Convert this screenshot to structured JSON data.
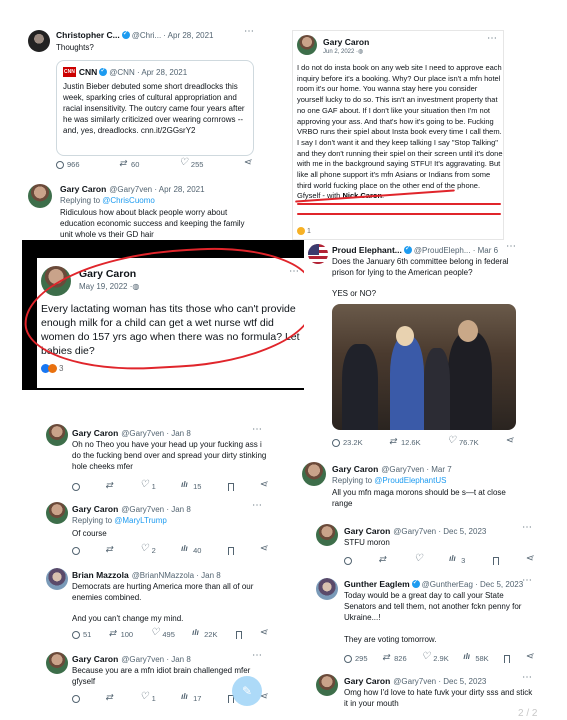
{
  "t1": {
    "name": "Christopher C... ",
    "handle": "@Chri...",
    "date": "· Apr 28, 2021",
    "text": "Thoughts?",
    "quote": {
      "logo": "CNN",
      "name": "CNN",
      "handle": "@CNN · Apr 28, 2021",
      "text": "Justin Bieber debuted some short dreadlocks this week, sparking cries of cultural appropriation and racial insensitivity. The outcry came four years after he was similarly criticized over wearing cornrows -- and, yes, dreadlocks. cnn.it/2GGsrY2"
    },
    "replies": "966",
    "retweets": "60",
    "likes": "255"
  },
  "t2": {
    "name": "Gary Caron",
    "handle": "@Gary7ven · Apr 28, 2021",
    "replying_prefix": "Replying to ",
    "replying_to": "@ChrisCuomo",
    "text": "Ridiculous how about black people worry about education economic success and keeping the family unit whole vs their GD hair"
  },
  "t3": {
    "name": "Gary Caron",
    "date": "Jun 2, 2022 · ",
    "text": "I do not do insta book on any web site I need to approve each inquiry before it's a booking. Why? Our place isn't a mfn hotel room it's our home. You wanna stay here you consider yourself lucky to do so. This isn't an investment property that no one GAF about. If I don't like your situation then I'm not approving your ass. And that's how it's going to be. Fucking VRBO runs their spiel about Insta book every time I call them. I say I don't want it and they keep talking I say \"Stop Talking\" and they don't running their spiel on their screen until it's done with me in the background saying STFU! It's aggravating. But like all phone support it's mfn Asians or Indians from some third world fucking place on the other end of the phone. Gfyself - with ",
    "with_name": "Nick Caron",
    "with_end": ".",
    "reaction_count": "1"
  },
  "t4": {
    "name": "Gary Caron",
    "date": "May 19, 2022 · ",
    "text": "Every lactating woman has tits those who can't provide enough milk for a child can get a wet nurse wtf did women do 157 yrs ago when there was no formula? Let babies die?",
    "reaction_count": "3"
  },
  "t5": {
    "name": "Proud Elephant...",
    "handle": "@ProudEleph... · Mar 6",
    "text": "Does the January 6th committee belong in federal prison for lying to the American people?",
    "text2": "YES or NO?",
    "replies": "23.2K",
    "retweets": "12.6K",
    "likes": "76.7K"
  },
  "t6": {
    "name": "Gary Caron",
    "handle": "@Gary7ven · Mar 7",
    "replying_prefix": "Replying to ",
    "replying_to": "@ProudElephantUS",
    "text": "All you mfn maga morons should be s—t at close range"
  },
  "t7": {
    "name": "Gary Caron",
    "handle": "@Gary7ven · Jan 8",
    "text": "Oh no Theo you have your head up your fucking ass i do the fucking bend over and spread your dirty stinking hole cheeks mfer",
    "likes": "1",
    "views": "15"
  },
  "t8": {
    "name": "Gary Caron",
    "handle": "@Gary7ven · Jan 8",
    "replying_prefix": "Replying to ",
    "replying_to": "@MaryLTrump",
    "text": "Of course",
    "likes": "2",
    "views": "40"
  },
  "t9": {
    "name": "Brian Mazzola",
    "handle": "@BrianNMazzola · Jan 8",
    "text": "Democrats are hurting America more than all of our enemies combined.",
    "text2": "And you can't change my mind.",
    "replies": "51",
    "retweets": "100",
    "likes": "495",
    "views": "22K"
  },
  "t10": {
    "name": "Gary Caron",
    "handle": "@Gary7ven · Jan 8",
    "text": "Because you are a mfn idiot brain challenged mfer gfyself",
    "likes": "1",
    "views": "17"
  },
  "t11": {
    "name": "Gary Caron",
    "handle": "@Gary7ven · Dec 5, 2023",
    "text": "STFU moron",
    "views": "3"
  },
  "t12": {
    "name": "Gunther Eaglem",
    "handle": "@GuntherEag · Dec 5, 2023",
    "text": "Today would be a great day to call your State Senators and tell them, not another fckn penny for Ukraine...!",
    "text2": "They are voting tomorrow.",
    "replies": "295",
    "retweets": "826",
    "likes": "2.9K",
    "views": "58K"
  },
  "t13": {
    "name": "Gary Caron",
    "handle": "@Gary7ven · Dec 5, 2023",
    "text": "Omg how I'd love to hate fuvk your dirty sss and stick it in your mouth"
  },
  "page_indicator": "2 / 2"
}
